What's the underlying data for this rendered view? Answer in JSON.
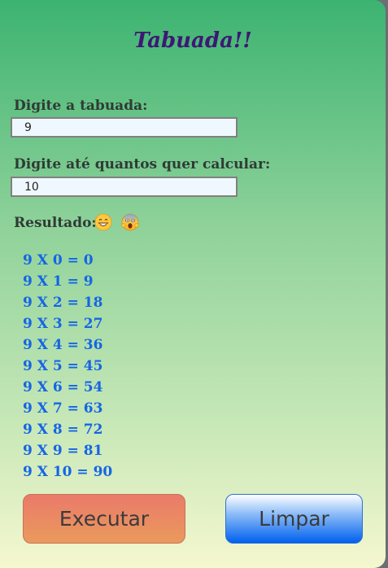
{
  "title": "Tabuada!!",
  "tabuada": {
    "label": "Digite a tabuada:",
    "value": "9"
  },
  "limite": {
    "label": "Digite até quantos quer calcular:",
    "value": "10"
  },
  "resultado": {
    "label": "Resultado:",
    "emojis": [
      "grinning-face-icon",
      "screaming-face-icon"
    ],
    "lines": [
      "9 X 0 = 0",
      "9 X 1 = 9",
      "9 X 2 = 18",
      "9 X 3 = 27",
      "9 X 4 = 36",
      "9 X 5 = 45",
      "9 X 6 = 54",
      "9 X 7 = 63",
      "9 X 8 = 72",
      "9 X 9 = 81",
      "9 X 10 = 90"
    ]
  },
  "buttons": {
    "execute": "Executar",
    "clear": "Limpar"
  },
  "colors": {
    "title": "#3d1873",
    "result_text": "#1565e6",
    "execute_button": "#ea8a64",
    "clear_button": "#0060ee"
  }
}
